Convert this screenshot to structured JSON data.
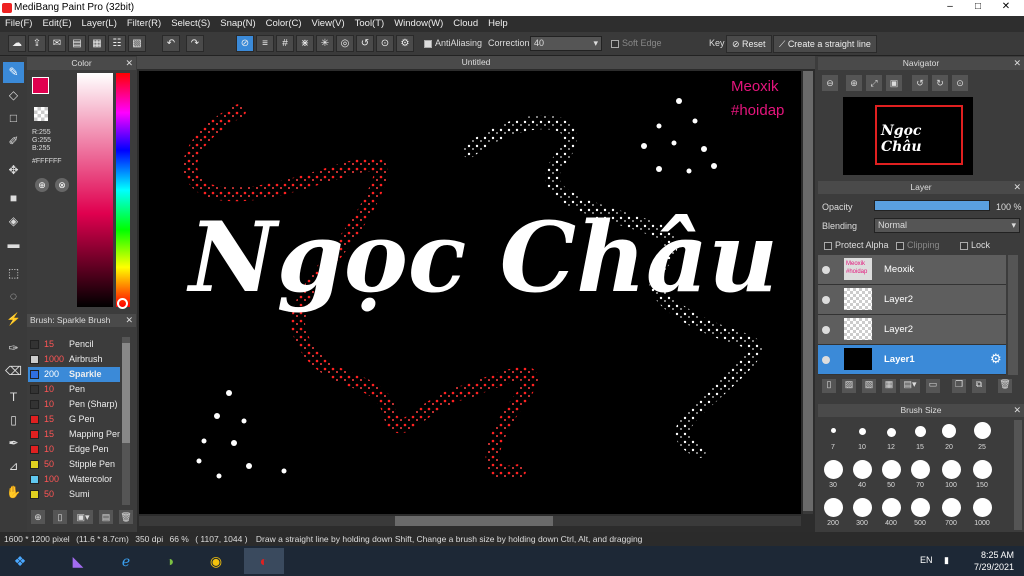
{
  "window": {
    "title": "MediBang Paint Pro (32bit)",
    "min": "–",
    "max": "□",
    "close": "✕"
  },
  "menu": [
    "File(F)",
    "Edit(E)",
    "Layer(L)",
    "Filter(R)",
    "Select(S)",
    "Snap(N)",
    "Color(C)",
    "View(V)",
    "Tool(T)",
    "Window(W)",
    "Cloud",
    "Help"
  ],
  "toolbar": {
    "antialiasing": "AntiAliasing",
    "correction_label": "Correction",
    "correction_value": "40",
    "soft_edge": "Soft Edge",
    "key_label": "Key",
    "reset": "Reset",
    "straight_line": "Create a straight line"
  },
  "color_panel": {
    "title": "Color",
    "r": "R:255",
    "g": "G:255",
    "b": "B:255",
    "hex": "#FFFFFF",
    "primary": "#e0004f",
    "accent": "#e4157c"
  },
  "brush_panel": {
    "title": "Brush: Sparkle Brush",
    "brushes": [
      {
        "size": "15",
        "name": "Pencil",
        "color": "#333333"
      },
      {
        "size": "1000",
        "name": "Airbrush",
        "color": "#cccccc"
      },
      {
        "size": "200",
        "name": "Sparkle",
        "color": "#2f6fe0"
      },
      {
        "size": "10",
        "name": "Pen",
        "color": "#333333"
      },
      {
        "size": "10",
        "name": "Pen (Sharp)",
        "color": "#333333"
      },
      {
        "size": "15",
        "name": "G Pen",
        "color": "#e02020"
      },
      {
        "size": "15",
        "name": "Mapping Pen",
        "color": "#e02020"
      },
      {
        "size": "10",
        "name": "Edge Pen",
        "color": "#e02020"
      },
      {
        "size": "50",
        "name": "Stipple Pen",
        "color": "#e0d020"
      },
      {
        "size": "100",
        "name": "Watercolor",
        "color": "#60c8f0"
      },
      {
        "size": "50",
        "name": "Sumi",
        "color": "#e0d020"
      }
    ]
  },
  "canvas": {
    "tab": "Untitled",
    "title_text": "Ngọc Châu",
    "watermark_1": "Meoxik",
    "watermark_2": "#hoidap"
  },
  "navigator": {
    "title": "Navigator"
  },
  "layer_panel": {
    "title": "Layer",
    "opacity_label": "Opacity",
    "opacity_value": "100 %",
    "opacity": 1.0,
    "blending_label": "Blending",
    "blending_value": "Normal",
    "protect_alpha": "Protect Alpha",
    "clipping": "Clipping",
    "lock": "Lock",
    "layers": [
      {
        "name": "Meoxik",
        "thumb_1": "Meoxik",
        "thumb_2": "#hoidap"
      },
      {
        "name": "Layer2"
      },
      {
        "name": "Layer2"
      },
      {
        "name": "Layer1"
      }
    ]
  },
  "brush_size": {
    "title": "Brush Size",
    "sizes": [
      "7",
      "10",
      "12",
      "15",
      "20",
      "25",
      "30",
      "40",
      "50",
      "70",
      "100",
      "150",
      "200",
      "300",
      "400",
      "500",
      "700",
      "1000"
    ]
  },
  "status": {
    "pixels": "1600 * 1200 pixel",
    "cm": "(11.6 * 8.7cm)",
    "dpi": "350 dpi",
    "zoom": "66 %",
    "coords": "( 1107, 1044 )",
    "hint": "Draw a straight line by holding down Shift, Change a brush size by holding down Ctrl, Alt, and dragging"
  },
  "taskbar": {
    "lang": "EN",
    "time": "8:25 AM",
    "date": "7/29/2021"
  }
}
